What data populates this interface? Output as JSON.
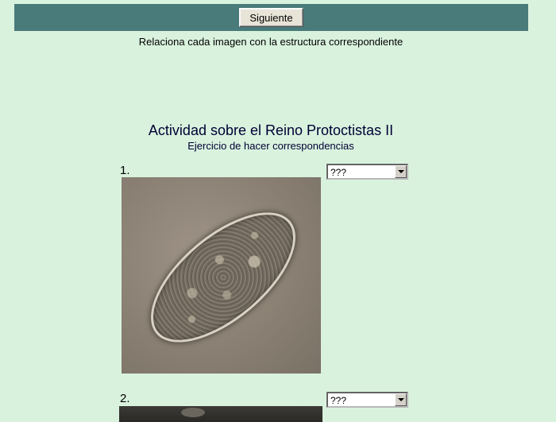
{
  "toolbar": {
    "next_label": "Siguiente",
    "bar_color": "#4a7b7b"
  },
  "instruction": "Relaciona cada imagen con la estructura correspondiente",
  "activity": {
    "title": "Actividad sobre el Reino Protoctistas II",
    "subtitle": "Ejercicio de hacer correspondencias"
  },
  "items": [
    {
      "number": "1.",
      "selected": "???"
    },
    {
      "number": "2.",
      "selected": "???"
    }
  ],
  "colors": {
    "background": "#d9f2de",
    "title": "#000033"
  }
}
